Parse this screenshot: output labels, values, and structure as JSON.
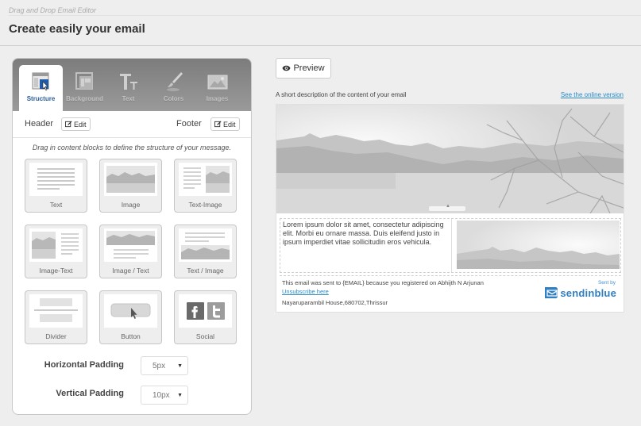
{
  "app": {
    "subtitle": "Drag and Drop Email Editor",
    "title": "Create easily your email"
  },
  "tabs": [
    {
      "label": "Structure",
      "icon": "structure-icon",
      "active": true
    },
    {
      "label": "Background",
      "icon": "background-icon",
      "active": false
    },
    {
      "label": "Text",
      "icon": "text-icon",
      "active": false
    },
    {
      "label": "Colors",
      "icon": "brush-icon",
      "active": false
    },
    {
      "label": "Images",
      "icon": "image-icon",
      "active": false
    }
  ],
  "header_footer": {
    "header_label": "Header",
    "footer_label": "Footer",
    "edit_label": "Edit"
  },
  "hint": "Drag in content blocks to define the structure of your message.",
  "blocks": [
    {
      "label": "Text"
    },
    {
      "label": "Image"
    },
    {
      "label": "Text-Image"
    },
    {
      "label": "Image-Text"
    },
    {
      "label": "Image / Text"
    },
    {
      "label": "Text / Image"
    },
    {
      "label": "Divider"
    },
    {
      "label": "Button"
    },
    {
      "label": "Social"
    }
  ],
  "padding": {
    "horizontal_label": "Horizontal Padding",
    "horizontal_value": "5px",
    "vertical_label": "Vertical Padding",
    "vertical_value": "10px"
  },
  "preview": {
    "button_label": "Preview",
    "description": "A short description of the content of your email",
    "online_link": "See the online version"
  },
  "email": {
    "body_text": "Lorem ipsum dolor sit amet, consectetur adipiscing elit. Morbi eu ornare massa. Duis eleifend justo in ipsum imperdiet vitae sollicitudin eros vehicula.",
    "footer_notice": "This email was sent to {EMAIL} because you registered on Abhijth N Arjunan",
    "unsubscribe": "Unsubscribe here",
    "address": "Nayaruparambil House,680702,Thrissur",
    "sent_by": "Sent by",
    "brand": "sendinblue",
    "brand_color": "#2f7fc2"
  }
}
